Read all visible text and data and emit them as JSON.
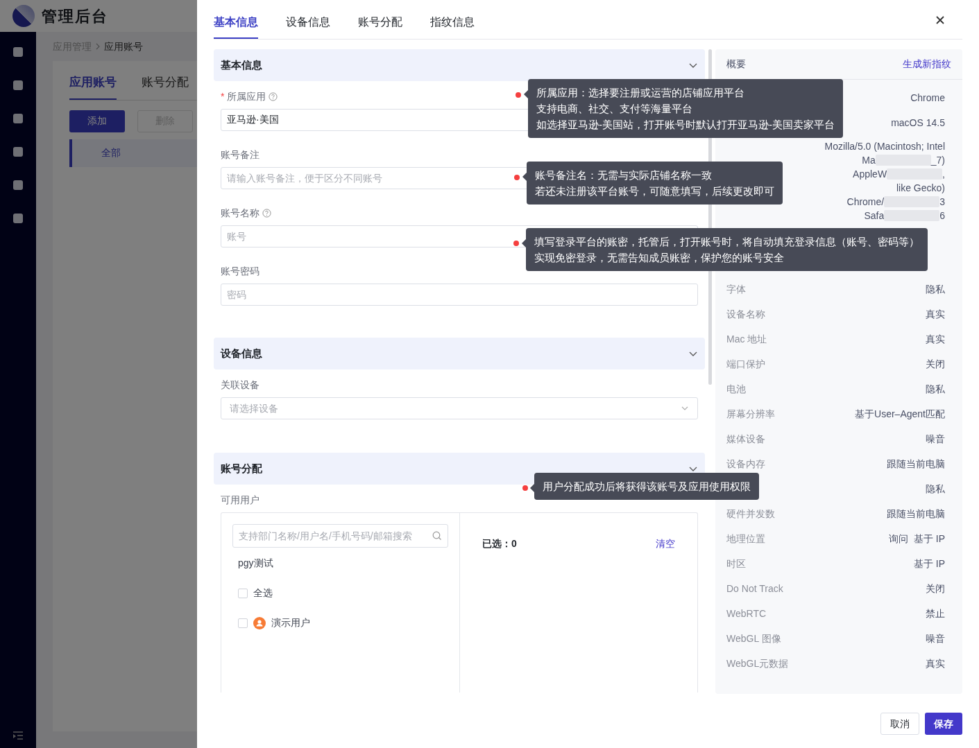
{
  "background_app": {
    "title": "管理后台",
    "breadcrumb": [
      "应用管理",
      "应用账号"
    ],
    "tabs": [
      {
        "label": "应用账号",
        "selected": true
      },
      {
        "label": "账号分配",
        "selected": false
      }
    ],
    "buttons": [
      {
        "label": "添加",
        "disabled": false
      },
      {
        "label": "删除",
        "disabled": true
      }
    ],
    "groups": [
      {
        "label": "全部",
        "selected": true
      }
    ]
  },
  "drawer": {
    "tabs": [
      {
        "label": "基本信息",
        "selected": true
      },
      {
        "label": "设备信息",
        "selected": false
      },
      {
        "label": "账号分配",
        "selected": false
      },
      {
        "label": "指纹信息",
        "selected": false
      }
    ],
    "sections": [
      {
        "title": "基本信息",
        "expanded": true,
        "fields": [
          {
            "kind": "input",
            "label": "所属应用",
            "required_mark": "*",
            "help": true,
            "value": "亚马逊·美国"
          },
          {
            "kind": "input",
            "label": "账号备注",
            "placeholder": "请输入账号备注，便于区分不同账号"
          },
          {
            "kind": "input",
            "label": "账号名称",
            "help": true,
            "placeholder": "账号"
          },
          {
            "kind": "input",
            "label": "账号密码",
            "placeholder": "密码"
          }
        ]
      },
      {
        "title": "设备信息",
        "expanded": true,
        "fields": [
          {
            "kind": "select",
            "label": "关联设备",
            "placeholder": "请选择设备"
          }
        ]
      },
      {
        "title": "账号分配",
        "expanded": true,
        "fields": [
          {
            "kind": "transfer",
            "label": "可用用户",
            "search_placeholder": "支持部门名称/用户名/手机号码/邮箱搜索",
            "group": "pgy测试",
            "options": [
              {
                "kind": "all",
                "label": "全选",
                "checked": false
              },
              {
                "kind": "user",
                "label": "演示用户",
                "checked": false
              }
            ],
            "selected_count_label": "已选：",
            "selected_count": "0",
            "clear": "清空"
          }
        ]
      }
    ],
    "fingerprint": {
      "title": "概要",
      "action": "生成新指纹",
      "rows": [
        {
          "kind": "row",
          "value": "Chrome"
        },
        {
          "kind": "row",
          "value": "macOS 14.5"
        },
        {
          "kind": "multiline",
          "lines": [
            [
              "Mozilla/5.0 (Macintosh; Intel"
            ],
            [
              "Ma",
              "_7)"
            ],
            [
              "AppleW",
              ","
            ],
            [
              "like Gecko)"
            ],
            [
              "Chrome/",
              "3"
            ],
            [
              "Safa",
              "6"
            ]
          ]
        },
        {
          "kind": "covered"
        },
        {
          "kind": "covered"
        },
        {
          "kind": "row",
          "label": "字体",
          "value": "隐私"
        },
        {
          "kind": "row",
          "label": "设备名称",
          "value": "真实"
        },
        {
          "kind": "row",
          "label": "Mac 地址",
          "value": "真实"
        },
        {
          "kind": "row",
          "label": "端口保护",
          "value": "关闭"
        },
        {
          "kind": "row",
          "label": "电池",
          "value": "隐私"
        },
        {
          "kind": "row",
          "label": "屏幕分辨率",
          "value": "基于User–Agent匹配"
        },
        {
          "kind": "row",
          "label": "媒体设备",
          "value": "噪音"
        },
        {
          "kind": "row",
          "label": "设备内存",
          "value": "跟随当前电脑"
        },
        {
          "kind": "row",
          "value": "隐私"
        },
        {
          "kind": "row",
          "label": "硬件并发数",
          "value": "跟随当前电脑"
        },
        {
          "kind": "row",
          "label": "地理位置",
          "value": "询问  基于 IP"
        },
        {
          "kind": "row",
          "label": "时区",
          "value": "基于 IP"
        },
        {
          "kind": "row",
          "label": "Do Not Track",
          "value": "关闭"
        },
        {
          "kind": "row",
          "label": "WebRTC",
          "value": "禁止"
        },
        {
          "kind": "row",
          "label": "WebGL 图像",
          "value": "噪音"
        },
        {
          "kind": "row",
          "label": "WebGL元数据",
          "value": "真实"
        }
      ]
    },
    "tooltips": [
      {
        "lines": [
          "所属应用：选择要注册或运营的店铺应用平台",
          "支持电商、社交、支付等海量平台",
          "如选择亚马逊-美国站，打开账号时默认打开亚马逊-美国卖家平台"
        ]
      },
      {
        "lines": [
          "账号备注名：无需与实际店铺名称一致",
          "若还未注册该平台账号，可随意填写，后续更改即可"
        ]
      },
      {
        "lines": [
          "填写登录平台的账密，托管后，打开账号时，将自动填充登录信息（账号、密码等）",
          "实现免密登录，无需告知成员账密，保护您的账号安全"
        ]
      },
      {
        "lines": [
          "用户分配成功后将获得该账号及应用使用权限"
        ]
      }
    ],
    "footer": [
      {
        "kind": "secondary",
        "label": "取消"
      },
      {
        "kind": "primary",
        "label": "保存"
      }
    ]
  }
}
